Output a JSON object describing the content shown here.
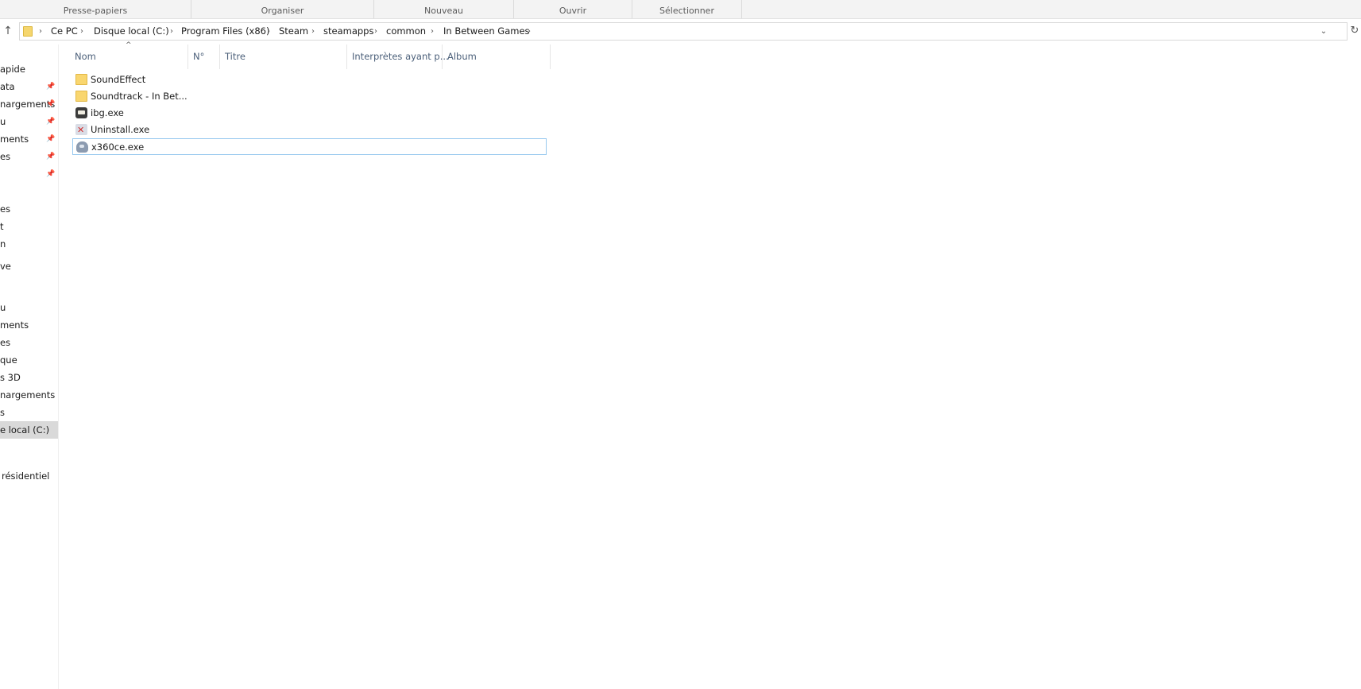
{
  "ribbon": {
    "groups": [
      "Presse-papiers",
      "Organiser",
      "Nouveau",
      "Ouvrir",
      "Sélectionner"
    ]
  },
  "address": {
    "crumbs": [
      "Ce PC",
      "Disque local (C:)",
      "Program Files (x86)",
      "Steam",
      "steamapps",
      "common",
      "In Between Games"
    ],
    "separator": "›"
  },
  "nav": {
    "items": [
      {
        "label": "apide",
        "pinned": false,
        "selected": false
      },
      {
        "label": "ata",
        "pinned": true,
        "selected": false
      },
      {
        "label": "nargements",
        "pinned": true,
        "selected": false
      },
      {
        "label": "u",
        "pinned": true,
        "selected": false
      },
      {
        "label": "ments",
        "pinned": true,
        "selected": false
      },
      {
        "label": "es",
        "pinned": true,
        "selected": false
      },
      {
        "label": "",
        "pinned": true,
        "selected": false
      },
      {
        "label": "es",
        "pinned": false,
        "selected": false
      },
      {
        "label": "t",
        "pinned": false,
        "selected": false
      },
      {
        "label": "n",
        "pinned": false,
        "selected": false
      },
      {
        "label": "ve",
        "pinned": false,
        "selected": false
      },
      {
        "label": "u",
        "pinned": false,
        "selected": false
      },
      {
        "label": "ments",
        "pinned": false,
        "selected": false
      },
      {
        "label": "es",
        "pinned": false,
        "selected": false
      },
      {
        "label": "que",
        "pinned": false,
        "selected": false
      },
      {
        "label": "s 3D",
        "pinned": false,
        "selected": false
      },
      {
        "label": "nargements",
        "pinned": false,
        "selected": false
      },
      {
        "label": "s",
        "pinned": false,
        "selected": false
      },
      {
        "label": "e local (C:)",
        "pinned": false,
        "selected": true
      },
      {
        "label": "résidentiel",
        "pinned": false,
        "selected": false
      }
    ]
  },
  "columns": [
    "Nom",
    "N°",
    "Titre",
    "Interprètes ayant p...",
    "Album"
  ],
  "sort": {
    "column": "Nom",
    "arrow": "^"
  },
  "files": [
    {
      "name": "SoundEffect",
      "icon": "folder-icon",
      "selected": false
    },
    {
      "name": "Soundtrack - In Bet...",
      "icon": "folder-icon",
      "selected": false
    },
    {
      "name": "ibg.exe",
      "icon": "ibg-app-icon",
      "selected": false
    },
    {
      "name": "Uninstall.exe",
      "icon": "uninstall-icon",
      "selected": false
    },
    {
      "name": "x360ce.exe",
      "icon": "gamepad-icon",
      "selected": true
    }
  ],
  "icons": {
    "up": "↑",
    "refresh": "↻",
    "dropdown": "⌄",
    "pin": "📌"
  }
}
